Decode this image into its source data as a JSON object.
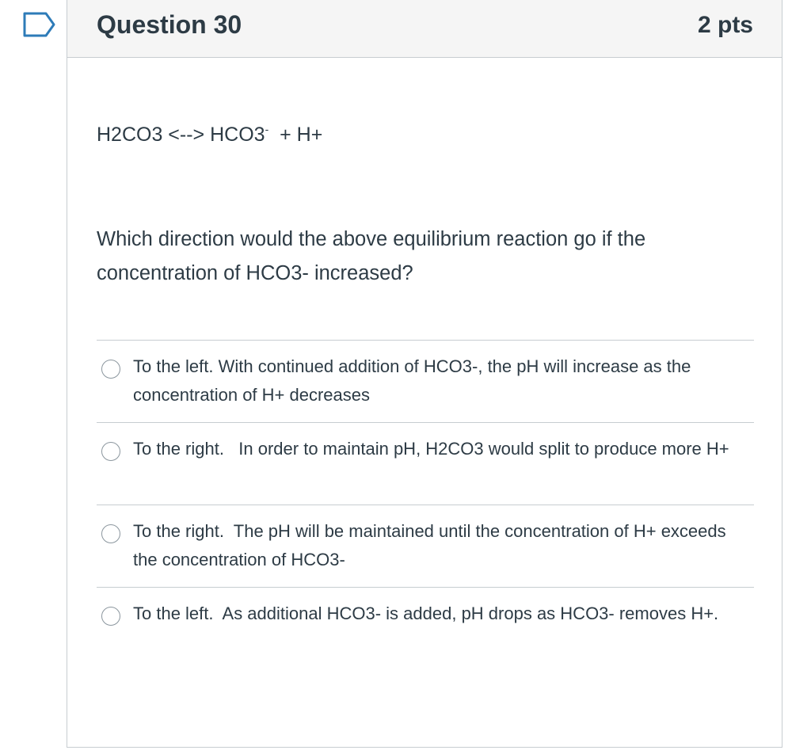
{
  "flag_icon": "bookmark-flag-icon",
  "colors": {
    "text": "#2d3b45",
    "header_bg": "#f5f5f5",
    "border": "#c7cdd1",
    "flag": "#2d7bb8"
  },
  "question": {
    "title": "Question 30",
    "points": "2 pts",
    "equation": {
      "left": "H2CO3 <--> HCO3",
      "superscript": "-",
      "right": "  + H+"
    },
    "prompt": "Which direction would the above equilibrium reaction go if the concentration of HCO3- increased?",
    "answers": [
      {
        "text": "To the left. With continued addition of HCO3-, the pH will increase as the concentration of H+ decreases"
      },
      {
        "text": "To the right.   In order to maintain pH, H2CO3 would split to produce more H+"
      },
      {
        "text": "To the right.  The pH will be maintained until the concentration of H+ exceeds the concentration of HCO3-"
      },
      {
        "text": "To the left.  As additional HCO3- is added, pH drops as HCO3- removes H+."
      }
    ]
  }
}
